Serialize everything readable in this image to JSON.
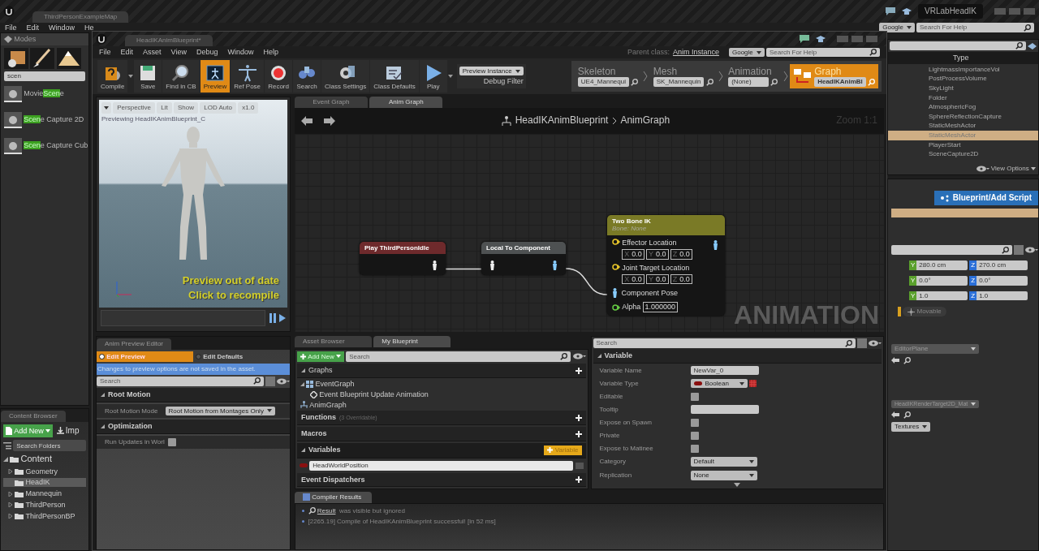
{
  "editor": {
    "map_tab": "ThirdPersonExampleMap",
    "menu": [
      "File",
      "Edit",
      "Window",
      "He"
    ],
    "project": "VRLabHeadIK",
    "help_provider": "Google",
    "help_placeholder": "Search For Help"
  },
  "modes_panel": {
    "title": "Modes",
    "search": "scen",
    "items": [
      {
        "before": "Movie",
        "match": "Scen",
        "after": "e"
      },
      {
        "match": "Scen",
        "after": "e Capture 2D"
      },
      {
        "match": "Scen",
        "after": "e Capture Cub"
      }
    ]
  },
  "content_browser": {
    "tab": "Content Browser",
    "add_new": "Add New",
    "import": "Imp",
    "search_placeholder": "Search Folders",
    "tree": [
      {
        "label": "Content",
        "expandable": true,
        "selected": false,
        "children": [
          {
            "label": "Geometry",
            "expandable": true,
            "selected": false
          },
          {
            "label": "HeadIK",
            "expandable": false,
            "selected": true
          },
          {
            "label": "Mannequin",
            "expandable": true,
            "selected": false
          },
          {
            "label": "ThirdPerson",
            "expandable": true,
            "selected": false
          },
          {
            "label": "ThirdPersonBP",
            "expandable": true,
            "selected": false
          }
        ]
      }
    ]
  },
  "outliner": {
    "column": "Type",
    "rows": [
      {
        "label": "LightmassImportanceVol",
        "selected": false
      },
      {
        "label": "PostProcessVolume",
        "selected": false
      },
      {
        "label": "SkyLight",
        "selected": false
      },
      {
        "label": "Folder",
        "selected": false
      },
      {
        "label": "AtmosphericFog",
        "selected": false
      },
      {
        "label": "SphereReflectionCapture",
        "selected": false
      },
      {
        "label": "StaticMeshActor",
        "selected": false
      },
      {
        "label": "StaticMeshActor",
        "selected": true
      },
      {
        "label": "PlayerStart",
        "selected": false
      },
      {
        "label": "SceneCapture2D",
        "selected": false
      }
    ],
    "view_options": "View Options"
  },
  "level_details": {
    "add_script": "Blueprint/Add Script",
    "transform": [
      {
        "fields": [
          {
            "axis": "Y",
            "value": "280.0 cm"
          },
          {
            "axis": "Z",
            "value": "270.0 cm"
          }
        ]
      },
      {
        "fields": [
          {
            "axis": "Y",
            "value": "0.0°"
          },
          {
            "axis": "Z",
            "value": "0.0°"
          }
        ]
      },
      {
        "fields": [
          {
            "axis": "Y",
            "value": "1.0"
          },
          {
            "axis": "Z",
            "value": "1.0"
          }
        ]
      }
    ],
    "mobility": "Movable",
    "material": "EditorPlane",
    "render_target": "HeadIKRenderTarget2D_Mat",
    "textures": "Textures"
  },
  "blueprint_editor": {
    "tab": "HeadIKAnimBlueprint*",
    "menu": [
      "File",
      "Edit",
      "Asset",
      "View",
      "Debug",
      "Window",
      "Help"
    ],
    "parent_class_label": "Parent class:",
    "parent_class": "Anim Instance",
    "help_provider": "Google",
    "help_placeholder": "Search For Help",
    "toolbar": [
      {
        "label": "Compile",
        "kind": "compile",
        "active": false
      },
      {
        "label": "Save",
        "kind": "save",
        "active": false
      },
      {
        "label": "Find in CB",
        "kind": "find",
        "active": false
      },
      {
        "label": "Preview",
        "kind": "preview",
        "active": true
      },
      {
        "label": "Ref Pose",
        "kind": "pose",
        "active": false
      },
      {
        "label": "Record",
        "kind": "record",
        "active": false
      },
      {
        "label": "Search",
        "kind": "search",
        "active": false
      },
      {
        "label": "Class Settings",
        "kind": "settings",
        "active": false
      },
      {
        "label": "Class Defaults",
        "kind": "defaults",
        "active": false
      },
      {
        "label": "Play",
        "kind": "play",
        "active": false
      }
    ],
    "debug": {
      "value": "Preview Instance",
      "label": "Debug Filter"
    },
    "asset_modes": [
      {
        "title": "Skeleton",
        "asset": "UE4_Mannequi",
        "selected": false
      },
      {
        "title": "Mesh",
        "asset": "SK_Mannequin",
        "selected": false
      },
      {
        "title": "Animation",
        "asset": "(None)",
        "selected": false
      },
      {
        "title": "Graph",
        "asset": "HeadIKAnimBl",
        "selected": true
      }
    ]
  },
  "viewport": {
    "buttons": [
      "Perspective",
      "Lit",
      "Show",
      "LOD Auto",
      "x1.0"
    ],
    "caption": "Previewing HeadIKAnimBlueprint_C",
    "warning": [
      "Preview out of date",
      "Click to recompile"
    ]
  },
  "graph": {
    "tabs": [
      {
        "label": "Event Graph",
        "selected": false
      },
      {
        "label": "Anim Graph",
        "selected": true
      }
    ],
    "breadcrumb": [
      "HeadIKAnimBlueprint",
      "AnimGraph"
    ],
    "zoom": "Zoom 1:1",
    "watermark": "ANIMATION",
    "nodes": [
      {
        "kind": "sequence",
        "title": "Play ThirdPersonIdle",
        "color": "#6e2a2c"
      },
      {
        "kind": "convert",
        "title": "Local To Component",
        "color": "#4e5152"
      },
      {
        "kind": "ik",
        "title": "Two Bone IK",
        "subtitle": "Bone: None",
        "color": "#7a7a26",
        "pins": [
          {
            "kind": "vector",
            "label": "Effector Location",
            "fields": [
              {
                "axis": "X",
                "value": "0.0"
              },
              {
                "axis": "Y",
                "value": "0.0"
              },
              {
                "axis": "Z",
                "value": "0.0"
              }
            ]
          },
          {
            "kind": "vector",
            "label": "Joint Target Location",
            "fields": [
              {
                "axis": "X",
                "value": "0.0"
              },
              {
                "axis": "Y",
                "value": "0.0"
              },
              {
                "axis": "Z",
                "value": "0.0"
              }
            ]
          },
          {
            "kind": "pose",
            "label": "Component Pose"
          },
          {
            "kind": "float",
            "label": "Alpha",
            "value": "1.000000"
          }
        ]
      }
    ]
  },
  "anim_preview": {
    "tab": "Anim Preview Editor",
    "tabs": [
      {
        "label": "Edit Preview",
        "selected": true
      },
      {
        "label": "Edit Defaults",
        "selected": false
      }
    ],
    "notice": "Changes to preview options are not saved in the asset.",
    "search_placeholder": "Search",
    "sections": [
      {
        "title": "Root Motion",
        "rows": [
          {
            "kind": "dropdown",
            "label": "Root Motion Mode",
            "value": "Root Motion from Montages Only"
          }
        ]
      },
      {
        "title": "Optimization",
        "rows": [
          {
            "kind": "checkbox",
            "label": "Run Updates in Worl",
            "checked": false
          }
        ]
      }
    ]
  },
  "my_blueprint": {
    "tabs": [
      {
        "label": "Asset Browser",
        "selected": false
      },
      {
        "label": "My Blueprint",
        "selected": true
      }
    ],
    "add_new": "Add New",
    "search_placeholder": "Search",
    "graphs": {
      "title": "Graphs",
      "items": [
        {
          "label": "EventGraph",
          "kind": "event-graph",
          "children": [
            {
              "label": "Event Blueprint Update Animation",
              "kind": "event"
            }
          ]
        },
        {
          "label": "AnimGraph",
          "kind": "anim-graph"
        }
      ]
    },
    "functions": {
      "title": "Functions",
      "note": "(3 Overridable)"
    },
    "macros": {
      "title": "Macros"
    },
    "variables": {
      "title": "Variables",
      "add_label": "Variable",
      "editing": "HeadWorldPosition"
    },
    "dispatchers": {
      "title": "Event Dispatchers"
    }
  },
  "details": {
    "search_placeholder": "Search",
    "section": "Variable",
    "rows": [
      {
        "kind": "text",
        "label": "Variable Name",
        "value": "NewVar_0"
      },
      {
        "kind": "type",
        "label": "Variable Type",
        "value": "Boolean"
      },
      {
        "kind": "checkbox",
        "label": "Editable",
        "checked": false
      },
      {
        "kind": "text",
        "label": "Tooltip"
      },
      {
        "kind": "checkbox",
        "label": "Expose on Spawn",
        "checked": false
      },
      {
        "kind": "checkbox",
        "label": "Private",
        "checked": false
      },
      {
        "kind": "checkbox",
        "label": "Expose to Matinee",
        "checked": false
      },
      {
        "kind": "dropdown",
        "label": "Category",
        "value": "Default"
      },
      {
        "kind": "dropdown",
        "label": "Replication",
        "value": "None"
      }
    ]
  },
  "compiler": {
    "tab": "Compiler Results",
    "lines": [
      {
        "kind": "link",
        "link": "Result",
        "text": "was visible but ignored"
      },
      {
        "kind": "plain",
        "text": "[2265.19] Compile of HeadIKAnimBlueprint successful! [in 52 ms]"
      }
    ]
  }
}
